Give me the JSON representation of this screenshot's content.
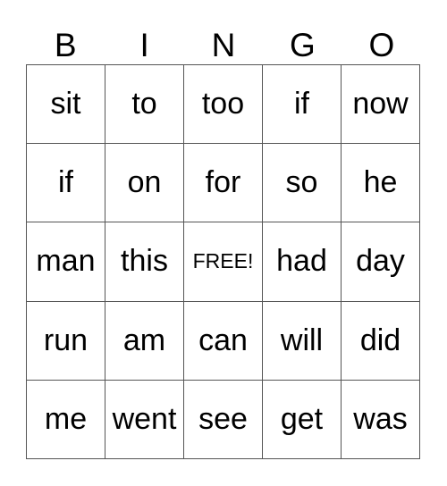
{
  "header": [
    "B",
    "I",
    "N",
    "G",
    "O"
  ],
  "cells": [
    [
      "sit",
      "to",
      "too",
      "if",
      "now"
    ],
    [
      "if",
      "on",
      "for",
      "so",
      "he"
    ],
    [
      "man",
      "this",
      "FREE!",
      "had",
      "day"
    ],
    [
      "run",
      "am",
      "can",
      "will",
      "did"
    ],
    [
      "me",
      "went",
      "see",
      "get",
      "was"
    ]
  ]
}
